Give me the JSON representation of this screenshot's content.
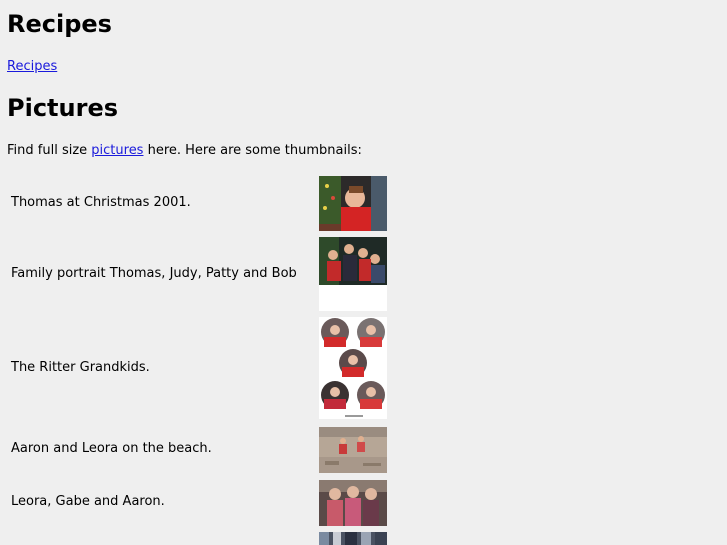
{
  "sections": {
    "recipes_heading": "Recipes",
    "recipes_link": "Recipes",
    "pictures_heading": "Pictures"
  },
  "intro": {
    "before": "Find full size ",
    "link": "pictures",
    "after": " here. Here are some thumbnails:"
  },
  "thumbnails": [
    {
      "caption": "Thomas at Christmas 2001."
    },
    {
      "caption": "Family portrait Thomas, Judy, Patty and Bob"
    },
    {
      "caption": "The Ritter Grandkids."
    },
    {
      "caption": "Aaron and Leora on the beach."
    },
    {
      "caption": "Leora, Gabe and Aaron."
    }
  ]
}
